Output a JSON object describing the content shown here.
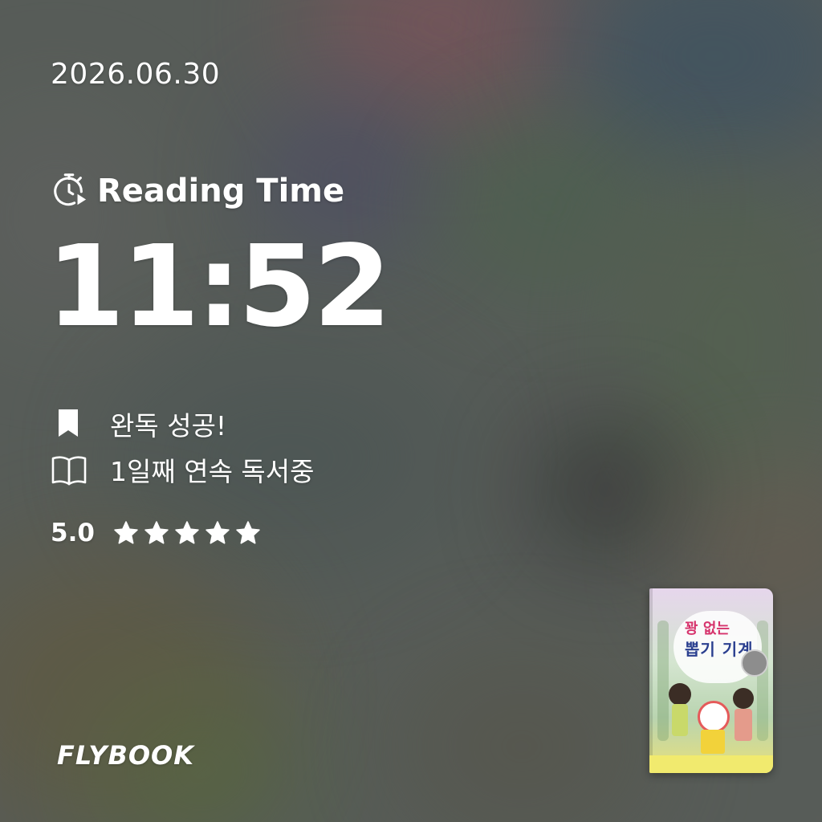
{
  "date": "2026.06.30",
  "reading": {
    "icon": "stopwatch-play-icon",
    "label": "Reading Time",
    "time": "11:52"
  },
  "stats": [
    {
      "icon": "bookmark-icon",
      "label": "완독 성공!"
    },
    {
      "icon": "open-book-icon",
      "label": "1일째 연속 독서중"
    }
  ],
  "rating": {
    "value": "5.0",
    "stars_filled": 5,
    "stars_total": 5
  },
  "brand": {
    "logo": "FLYBOOK"
  },
  "book": {
    "title_line1": "꽝 없는",
    "title_line2": "뽑기 기계"
  },
  "colors": {
    "text": "#ffffff",
    "cover_title_pink": "#d6336c",
    "cover_title_blue": "#2a3f8f"
  }
}
